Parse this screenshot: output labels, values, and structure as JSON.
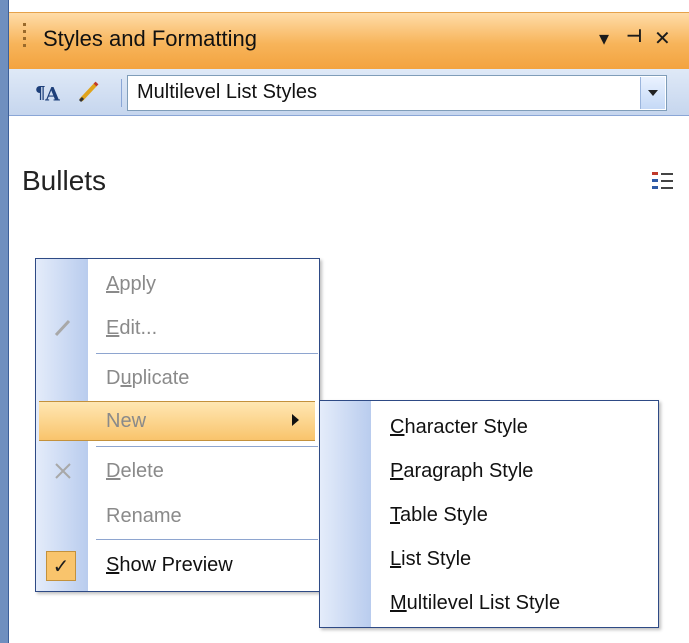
{
  "panel": {
    "title": "Styles and Formatting",
    "controls": {
      "dropdown_glyph": "▾",
      "pin_glyph": "⊣",
      "close_glyph": "✕"
    }
  },
  "toolbar": {
    "style_icon": "pilcrow-a-icon",
    "pencil_icon": "pencil-icon",
    "dropdown_value": "Multilevel List Styles"
  },
  "content": {
    "style_name": "Bullets",
    "list_icon": "numbered-list-icon"
  },
  "context_menu": {
    "items": [
      {
        "label_pre": "",
        "label_u": "A",
        "label_post": "pply",
        "enabled": false,
        "icon": ""
      },
      {
        "label_pre": "",
        "label_u": "E",
        "label_post": "dit...",
        "enabled": false,
        "icon": "pencil-icon"
      },
      {
        "label_pre": "D",
        "label_u": "u",
        "label_post": "plicate",
        "enabled": false,
        "icon": ""
      },
      {
        "label_pre": "New",
        "label_u": "",
        "label_post": "",
        "enabled": true,
        "icon": "",
        "has_submenu": true
      },
      {
        "label_pre": "",
        "label_u": "D",
        "label_post": "elete",
        "enabled": false,
        "icon": "delete-x-icon"
      },
      {
        "label_pre": "Rename",
        "label_u": "",
        "label_post": "",
        "enabled": false,
        "icon": ""
      },
      {
        "label_pre": "",
        "label_u": "S",
        "label_post": "how Preview",
        "enabled": true,
        "icon": "checkmark-icon",
        "checked": true
      }
    ]
  },
  "submenu": {
    "items": [
      {
        "label_u": "C",
        "label_post": "haracter Style"
      },
      {
        "label_u": "P",
        "label_post": "aragraph Style"
      },
      {
        "label_u": "T",
        "label_post": "able Style"
      },
      {
        "label_u": "L",
        "label_post": "ist Style"
      },
      {
        "label_u": "M",
        "label_post": "ultilevel List Style"
      }
    ]
  },
  "colors": {
    "title_gradient_top": "#ffdca8",
    "title_gradient_bottom": "#f3a33f",
    "menu_highlight": "#f9c46c",
    "menu_border": "#2e4a85",
    "gutter": "#b9ccee"
  }
}
